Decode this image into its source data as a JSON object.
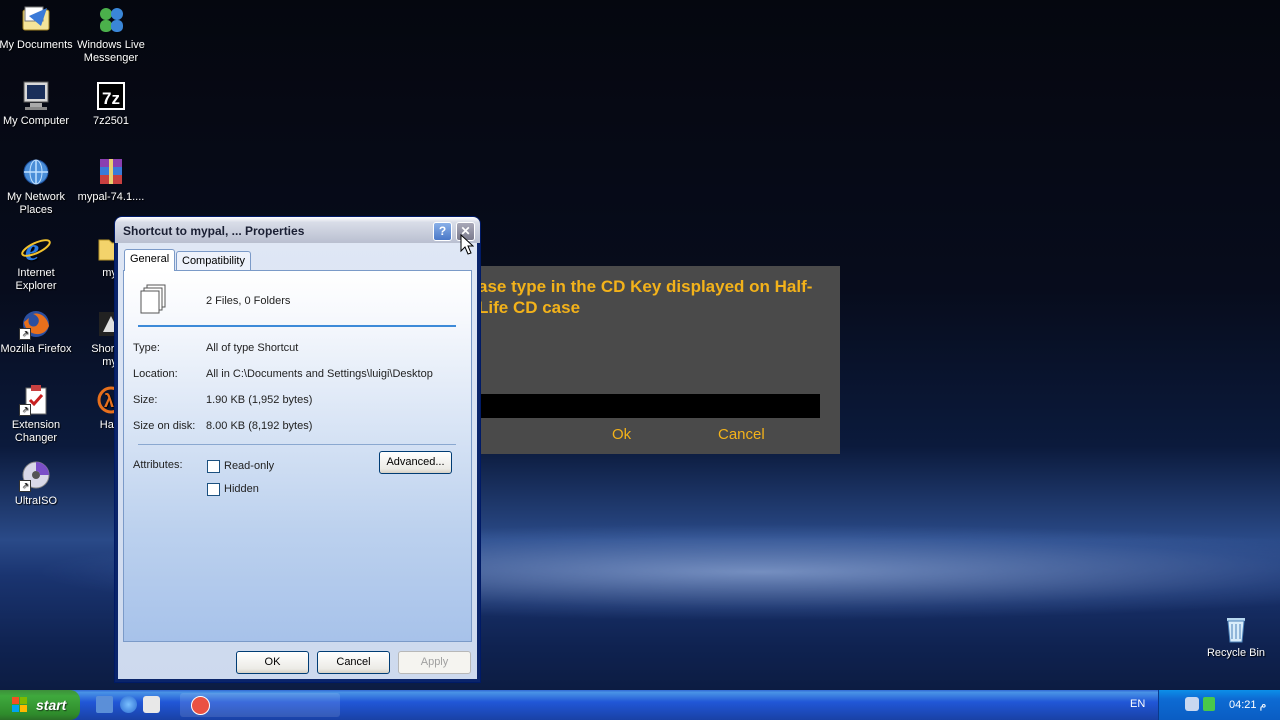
{
  "desktop_icons": [
    {
      "label": "My Documents"
    },
    {
      "label": "Windows Live Messenger"
    },
    {
      "label": "My Computer"
    },
    {
      "label": "7z2501"
    },
    {
      "label": "My Network Places"
    },
    {
      "label": "mypal-74.1...."
    },
    {
      "label": "Internet Explorer"
    },
    {
      "label": "myp"
    },
    {
      "label": "Mozilla Firefox"
    },
    {
      "label": "Shortc myp"
    },
    {
      "label": "Extension Changer"
    },
    {
      "label": "Half-"
    },
    {
      "label": "UltraISO"
    },
    {
      "label": "Recycle Bin"
    }
  ],
  "game_dialog": {
    "prompt": "ase type in the CD Key displayed on  Half-Life CD case",
    "ok_label": "Ok",
    "cancel_label": "Cancel"
  },
  "properties": {
    "title": "Shortcut to mypal, ... Properties",
    "help_glyph": "?",
    "close_glyph": "✕",
    "tabs": [
      {
        "label": "General"
      },
      {
        "label": "Compatibility"
      }
    ],
    "summary": "2 Files, 0 Folders",
    "fields": {
      "type_label": "Type:",
      "type_value": "All of type Shortcut",
      "location_label": "Location:",
      "location_value": "All in C:\\Documents and Settings\\luigi\\Desktop",
      "size_label": "Size:",
      "size_value": "1.90 KB (1,952 bytes)",
      "size_on_disk_label": "Size on disk:",
      "size_on_disk_value": "8.00 KB (8,192 bytes)"
    },
    "attributes_label": "Attributes:",
    "readonly_label": "Read-only",
    "hidden_label": "Hidden",
    "advanced_label": "Advanced...",
    "ok_label": "OK",
    "cancel_label": "Cancel",
    "apply_label": "Apply"
  },
  "taskbar": {
    "start_label": "start",
    "language": "EN",
    "clock": "04:21 م"
  },
  "colors": {
    "game_text": "#f3b21a",
    "xp_blue": "#245edb",
    "close_red": "#d9532b"
  }
}
